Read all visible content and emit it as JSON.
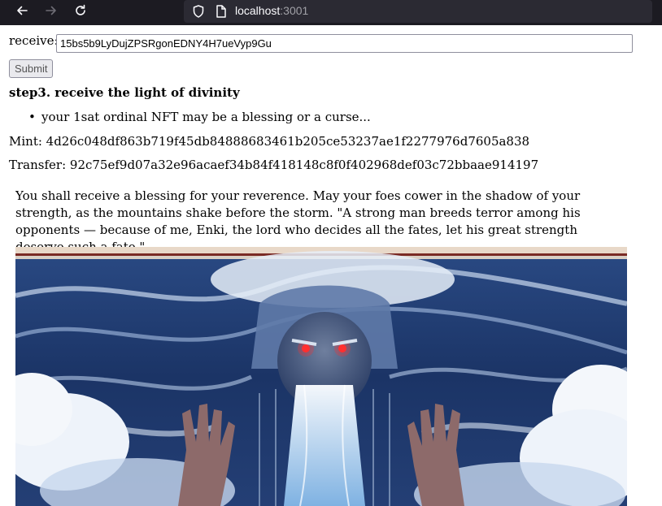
{
  "browser": {
    "url_host": "localhost",
    "url_port": ":3001",
    "icons": [
      "back-arrow-icon",
      "forward-arrow-icon",
      "reload-icon",
      "shield-icon",
      "page-icon"
    ]
  },
  "form": {
    "receive_label": "receive:",
    "receive_value": "15bs5b9LyDujZPSRgonEDNY4H7ueVyp9Gu",
    "submit_label": "Submit"
  },
  "step": {
    "title": "step3. receive the light of divinity",
    "bullets": [
      "your 1sat ordinal NFT may be a blessing or a curse..."
    ]
  },
  "mint": "Mint: 4d26c048df863b719f45db84888683461b205ce53237ae1f2277976d7605a838",
  "transfer": "Transfer: 92c75ef9d07a32e96acaef34b84f418148c8f0f402968def03c72bbaae914197",
  "blessing_text": "You shall receive a blessing for your reverence. May your foes cower in the shadow of your strength, as the mountains shake before the storm. \"A strong man breeds terror among his opponents — because of me, Enki, the lord who decides all the fates, let his great strength deserve such a fate.\"",
  "colors": {
    "chrome_bg": "#1c1b22",
    "urlbar_bg": "#2b2a33",
    "art_sky": "#1c3563",
    "art_cloud": "#e6eef8",
    "eye_red": "#ff3030"
  }
}
